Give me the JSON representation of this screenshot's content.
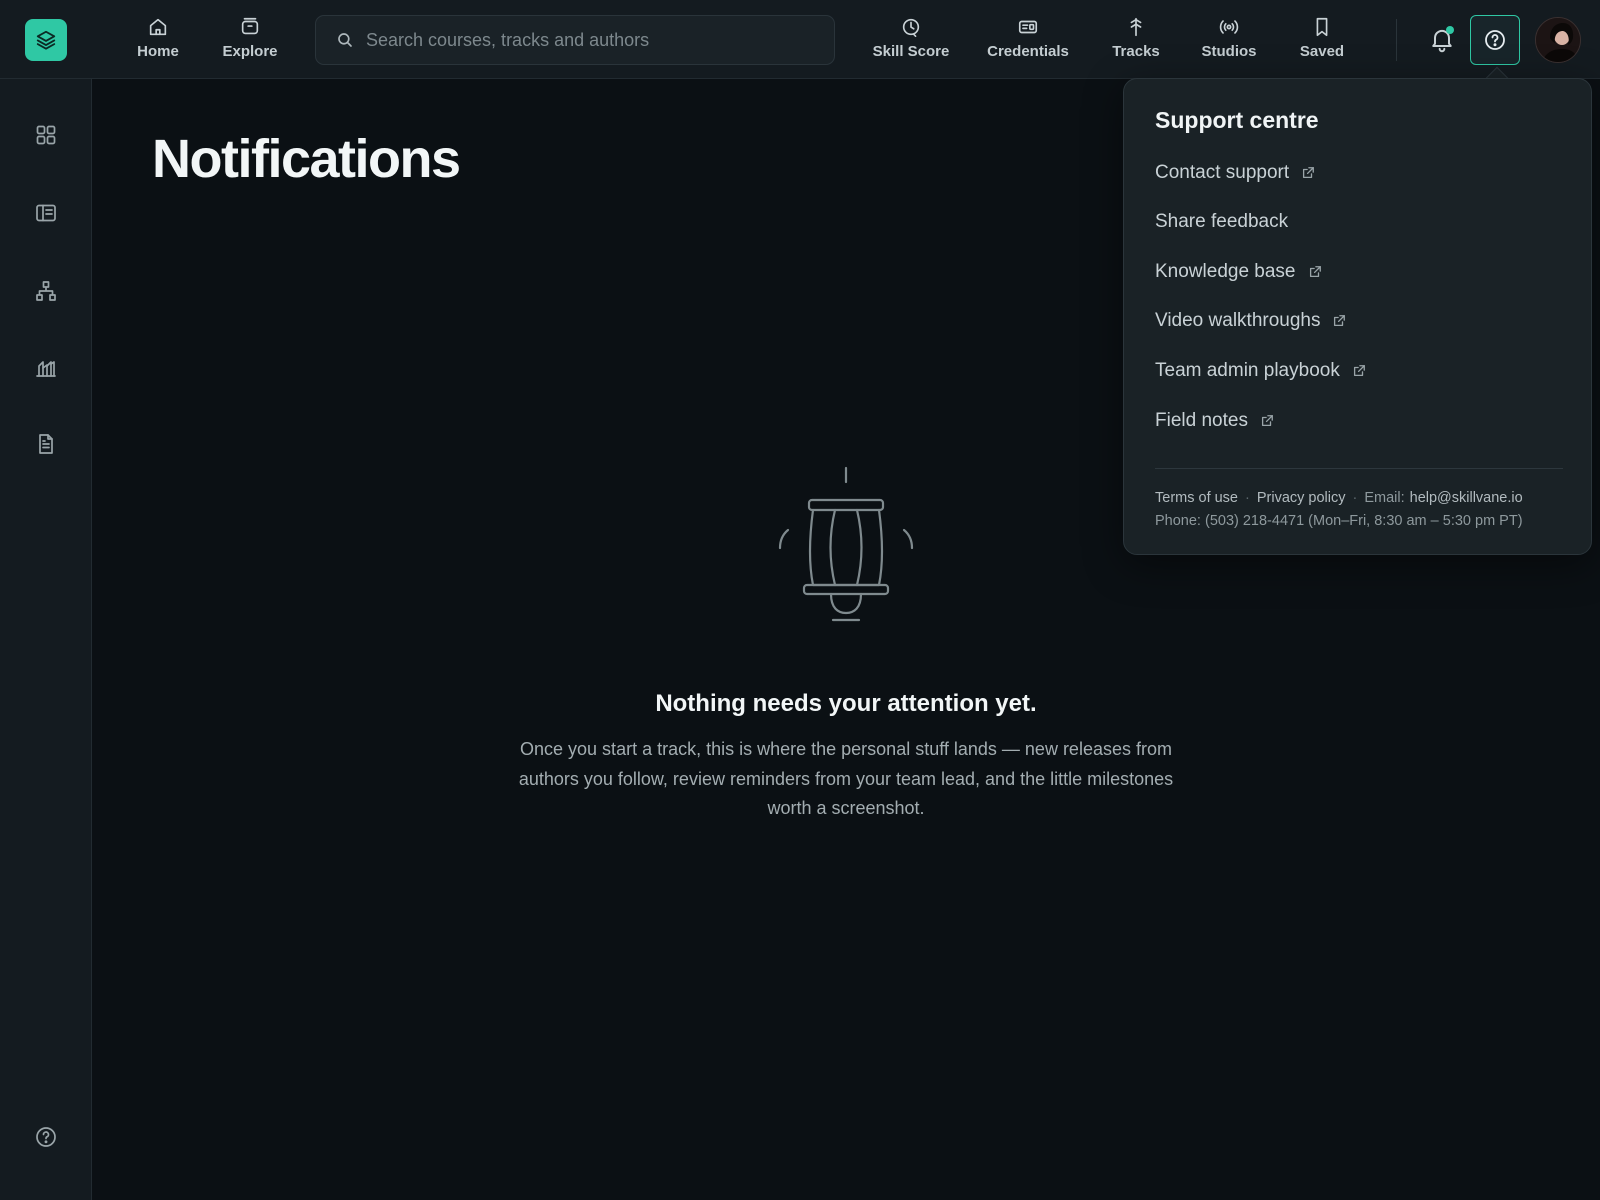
{
  "topbar": {
    "nav": [
      {
        "label": "Home",
        "icon": "home-icon"
      },
      {
        "label": "Explore",
        "icon": "inbox-icon"
      },
      {
        "label": "Skill Score",
        "icon": "skill-score-icon"
      },
      {
        "label": "Credentials",
        "icon": "id-card-icon"
      },
      {
        "label": "Tracks",
        "icon": "signpost-icon"
      },
      {
        "label": "Studios",
        "icon": "broadcast-icon"
      },
      {
        "label": "Saved",
        "icon": "bookmark-icon"
      }
    ],
    "search_placeholder": "Search courses, tracks and authors"
  },
  "colors": {
    "accent": "#2fc8a4",
    "background": "#0b1014",
    "surface": "#141b20",
    "panel": "#1a2226"
  },
  "main": {
    "title": "Notifications",
    "empty_title": "Nothing needs your attention yet.",
    "empty_body": "Once you start a track, this is where the personal stuff lands — new releases from authors you follow, review reminders from your team lead, and the little milestones worth a screenshot."
  },
  "support": {
    "title": "Support centre",
    "links": [
      {
        "label": "Contact support",
        "external": true
      },
      {
        "label": "Share feedback",
        "external": false
      },
      {
        "label": "Knowledge base",
        "external": true
      },
      {
        "label": "Video walkthroughs",
        "external": true
      },
      {
        "label": "Team admin playbook",
        "external": true
      },
      {
        "label": "Field notes",
        "external": true
      }
    ],
    "terms": "Terms of use",
    "privacy": "Privacy policy",
    "email_label": "Email:",
    "email": "help@skillvane.io",
    "phone": "Phone: (503) 218-4471 (Mon–Fri, 8:30 am – 5:30 pm PT)"
  }
}
